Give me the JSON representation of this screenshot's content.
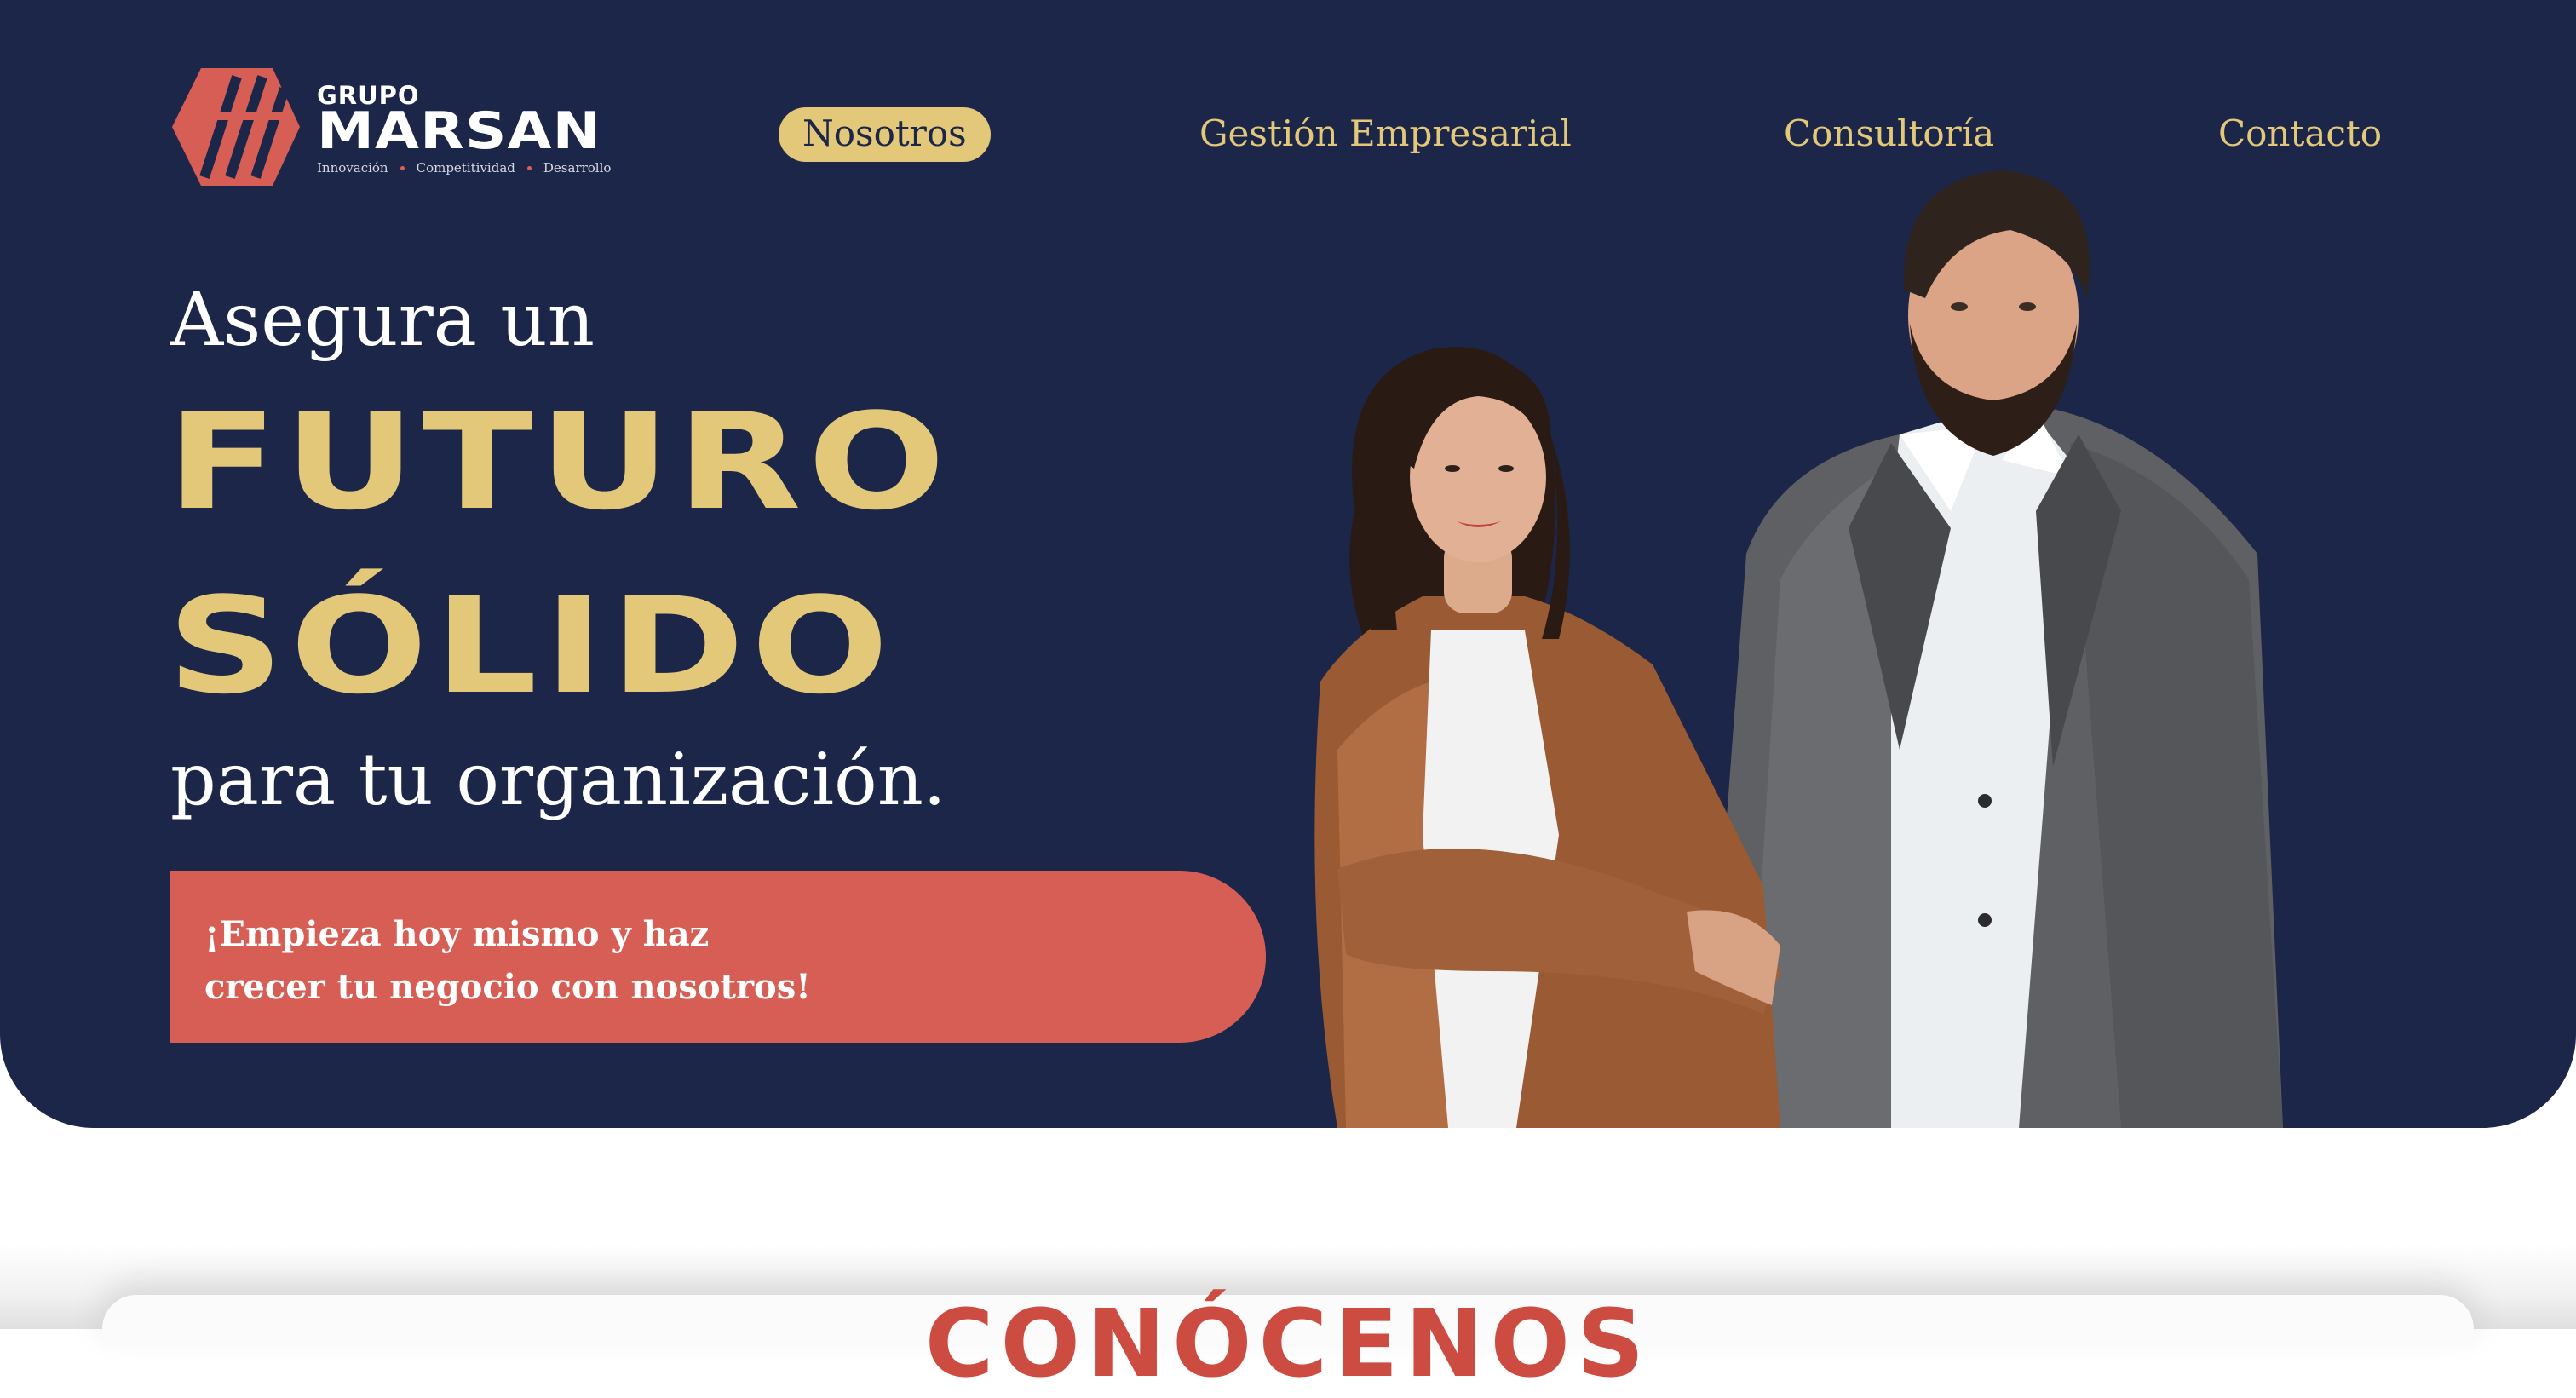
{
  "brand": {
    "small": "GRUPO",
    "big": "MARSAN",
    "tags": [
      "Innovación",
      "Competitividad",
      "Desarrollo"
    ],
    "colors": {
      "navy": "#1b2649",
      "gold": "#e3c87a",
      "coral": "#d75e54",
      "white": "#ffffff"
    }
  },
  "nav": {
    "items": [
      {
        "label": "Nosotros",
        "active": true
      },
      {
        "label": "Gestión Empresarial",
        "active": false
      },
      {
        "label": "Consultoría",
        "active": false
      },
      {
        "label": "Contacto",
        "active": false
      }
    ]
  },
  "hero": {
    "pre": "Asegura un",
    "big_line1": "FUTURO",
    "big_line2": "SÓLIDO",
    "post": "para tu organización.",
    "cta_line1": "¡Empieza hoy mismo y haz",
    "cta_line2": "crecer tu negocio con nosotros!"
  },
  "section": {
    "title": "CONÓCENOS"
  }
}
